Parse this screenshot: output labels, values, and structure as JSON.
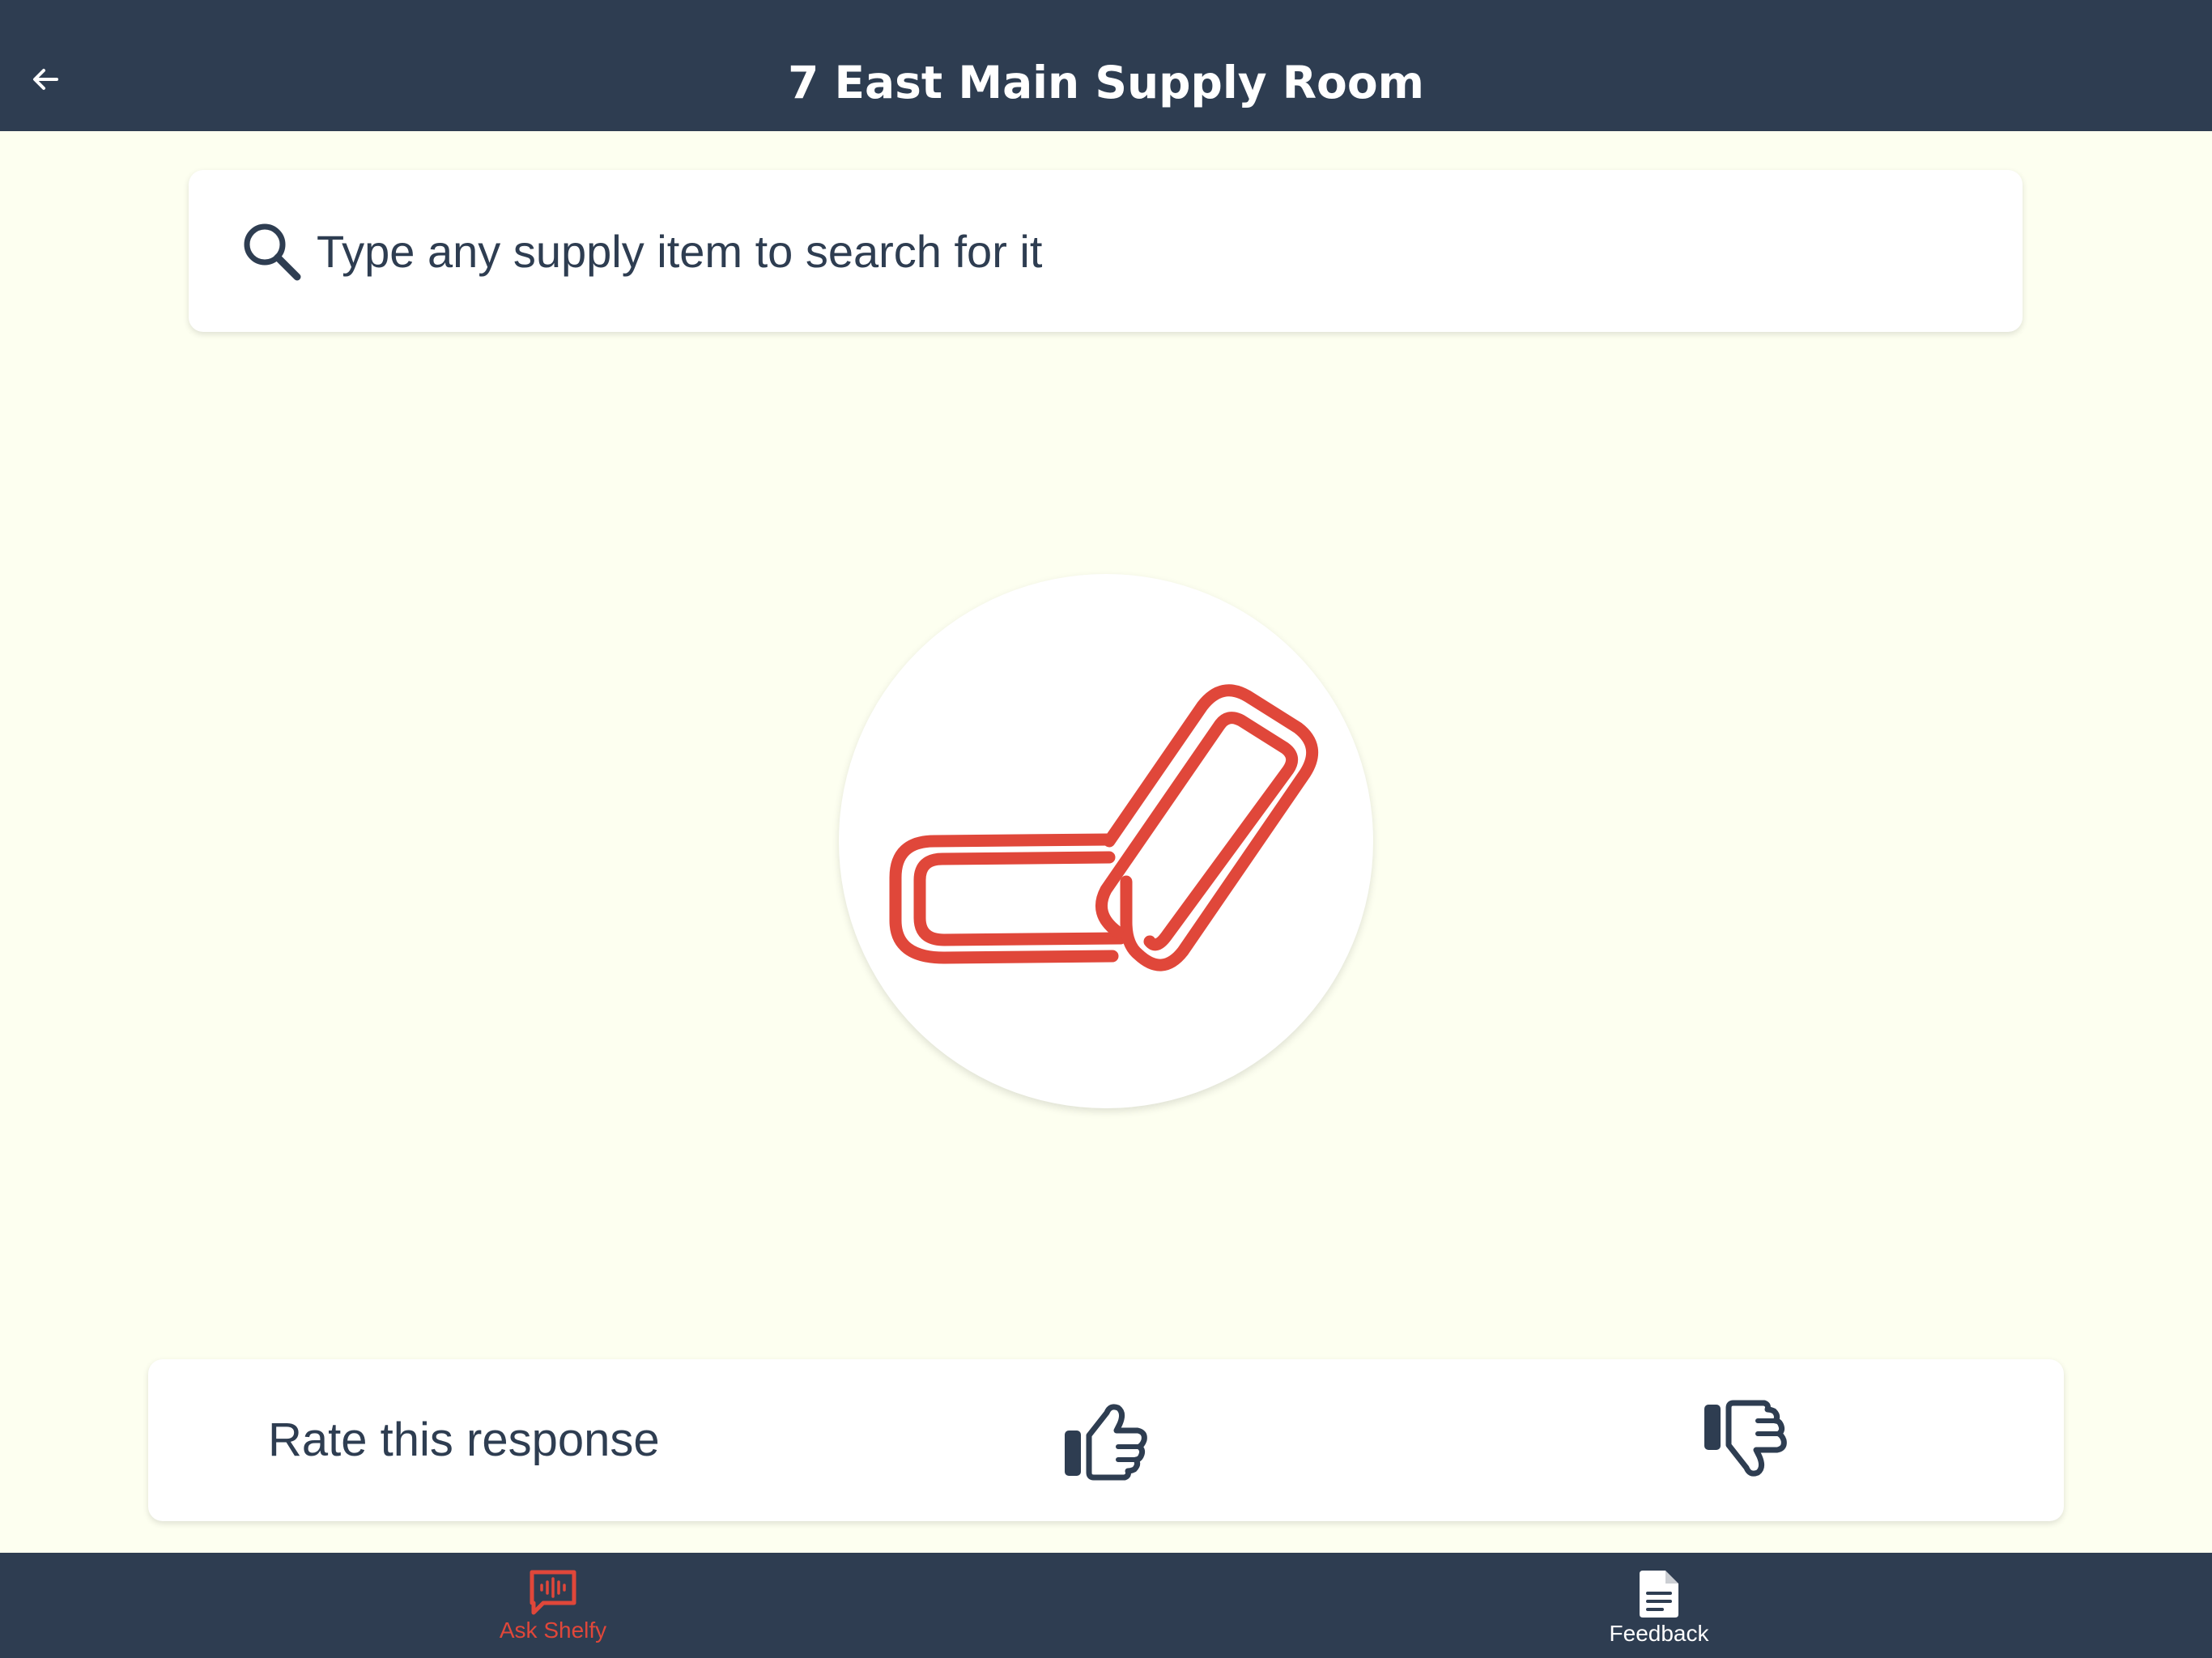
{
  "header": {
    "title": "7 East Main Supply Room",
    "back_icon": "arrow-left-icon"
  },
  "search": {
    "placeholder": "Type any supply item to search for it",
    "value": "",
    "icon": "search-icon"
  },
  "logo": {
    "icon": "paperclip-chain-icon",
    "color": "#E0473A"
  },
  "rating": {
    "label": "Rate this response",
    "thumbs_up_icon": "thumbs-up-icon",
    "thumbs_down_icon": "thumbs-down-icon"
  },
  "bottom_nav": {
    "items": [
      {
        "label": "Ask Shelfy",
        "icon": "voice-message-icon",
        "active": true
      },
      {
        "label": "Feedback",
        "icon": "document-icon",
        "active": false
      }
    ]
  },
  "colors": {
    "header_bg": "#2E3D51",
    "page_bg": "#FDFFF0",
    "accent": "#E0473A",
    "text": "#2E3D51"
  }
}
